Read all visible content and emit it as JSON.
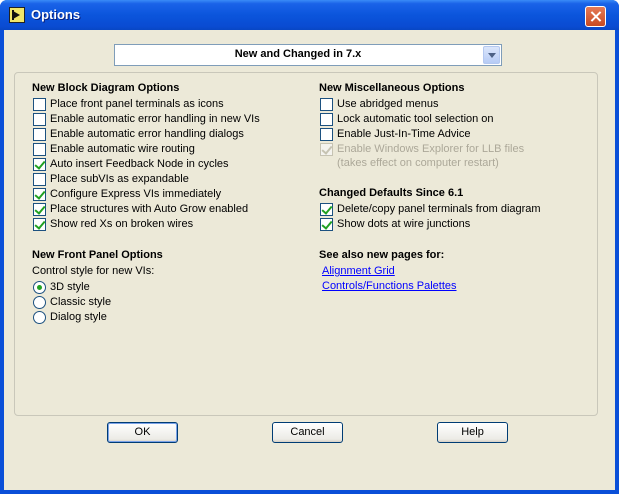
{
  "window": {
    "title": "Options"
  },
  "category_select": {
    "value": "New and Changed in 7.x"
  },
  "block_diagram": {
    "title": "New Block Diagram Options",
    "items": [
      {
        "label": "Place front panel terminals as icons",
        "checked": false
      },
      {
        "label": "Enable automatic error handling in new VIs",
        "checked": false
      },
      {
        "label": "Enable automatic error handling dialogs",
        "checked": false
      },
      {
        "label": "Enable automatic wire routing",
        "checked": false
      },
      {
        "label": "Auto insert Feedback Node in cycles",
        "checked": true
      },
      {
        "label": "Place subVIs as expandable",
        "checked": false
      },
      {
        "label": "Configure Express VIs immediately",
        "checked": true
      },
      {
        "label": "Place structures with Auto Grow enabled",
        "checked": true
      },
      {
        "label": "Show red Xs on broken wires",
        "checked": true
      }
    ]
  },
  "front_panel": {
    "title": "New Front Panel Options",
    "control_style_label": "Control style for new VIs:",
    "styles": [
      {
        "label": "3D style",
        "selected": true
      },
      {
        "label": "Classic style",
        "selected": false
      },
      {
        "label": "Dialog style",
        "selected": false
      }
    ]
  },
  "misc": {
    "title": "New Miscellaneous Options",
    "items": [
      {
        "label": "Use abridged menus",
        "checked": false
      },
      {
        "label": "Lock automatic tool selection on",
        "checked": false
      },
      {
        "label": "Enable Just-In-Time Advice",
        "checked": false
      },
      {
        "label": "Enable Windows Explorer for LLB files",
        "checked": true,
        "disabled": true
      }
    ],
    "restart_note": "(takes effect on computer restart)"
  },
  "changed_defaults": {
    "title": "Changed Defaults Since 6.1",
    "items": [
      {
        "label": "Delete/copy panel terminals from diagram",
        "checked": true
      },
      {
        "label": "Show dots at wire junctions",
        "checked": true
      }
    ]
  },
  "see_also": {
    "title": "See also new pages for:",
    "links": [
      "Alignment Grid",
      "Controls/Functions Palettes"
    ]
  },
  "buttons": {
    "ok": "OK",
    "cancel": "Cancel",
    "help": "Help"
  },
  "colors": {
    "titlebar": "#0b55dc",
    "dialog": "#ece9d8",
    "check": "#21a121",
    "link": "#0000ff"
  },
  "icons": {
    "app": "labview-run-icon",
    "close": "close-icon",
    "dropdown": "chevron-down-icon"
  }
}
